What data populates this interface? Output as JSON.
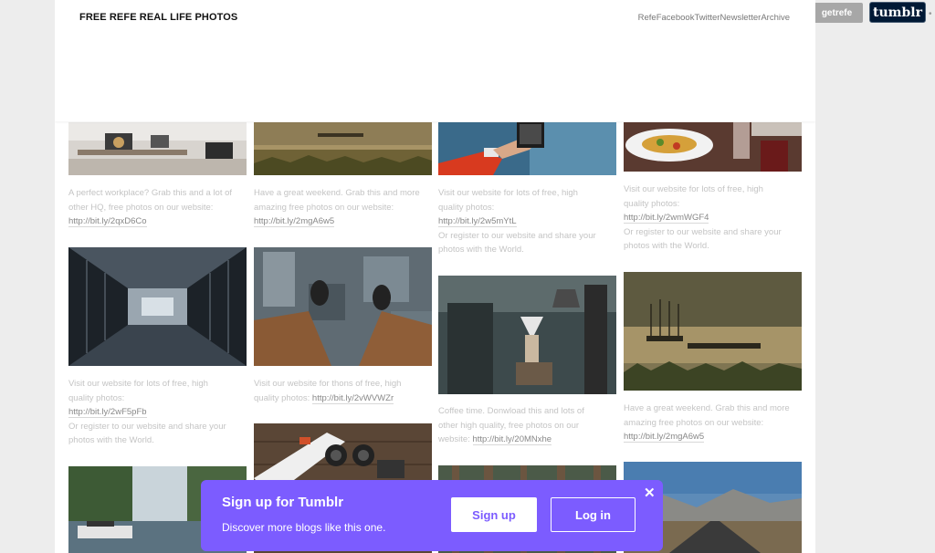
{
  "blog": {
    "title": "FREE REFE REAL LIFE PHOTOS",
    "nav": [
      "Refe",
      "Facebook",
      "Twitter",
      "Newsletter",
      "Archive"
    ]
  },
  "tumblr_controls": {
    "follow_label": "getrefe",
    "logo_label": "tumblr"
  },
  "posts": {
    "col1": [
      {
        "photo_icon": "office-workplace-photo",
        "caption": [
          "A perfect workplace? Grab this and a lot of",
          "other HQ, free photos on our website:"
        ],
        "link": "http://bit.ly/2qxD6Co"
      },
      {
        "photo_icon": "industrial-corridor-photo",
        "caption": [
          "Visit our website for lots of free, high",
          "quality photos:"
        ],
        "link": "http://bit.ly/2wF5pFb",
        "after": [
          "Or register to our website and share your",
          "photos with the World."
        ]
      },
      {
        "photo_icon": "river-canal-photo"
      }
    ],
    "col2": [
      {
        "photo_icon": "misty-lake-photo",
        "caption": [
          "Have a great weekend. Grab this and more",
          "amazing free photos on our website:"
        ],
        "link": "http://bit.ly/2mgA6w5"
      },
      {
        "photo_icon": "feet-above-city-photo",
        "caption": [
          "Visit our website for thons of free, high"
        ],
        "inline_prefix": "quality photos: ",
        "link": "http://bit.ly/2vWVWZr"
      },
      {
        "photo_icon": "skateboard-photo"
      }
    ],
    "col3": [
      {
        "photo_icon": "phone-in-hand-photo",
        "caption": [
          "Visit our website for lots of free, high",
          "quality photos:"
        ],
        "link": "http://bit.ly/2w5mYtL",
        "after": [
          "Or register to our website and share your",
          "photos with the World."
        ]
      },
      {
        "photo_icon": "coffee-brewing-photo",
        "caption": [
          "Coffee time. Donwload this and lots of",
          "other high quality, free photos on our"
        ],
        "inline_prefix": "website: ",
        "link": "http://bit.ly/20MNxhe"
      },
      {
        "photo_icon": "forest-photo"
      }
    ],
    "col4": [
      {
        "photo_icon": "restaurant-dinner-photo",
        "caption": [
          "Visit our website for lots of free, high",
          "quality photos:"
        ],
        "link": "http://bit.ly/2wmWGF4",
        "after": [
          "Or register to our website and share your",
          "photos with the World."
        ]
      },
      {
        "photo_icon": "misty-lake-boat-photo",
        "caption": [
          "Have a great weekend. Grab this and more",
          "amazing free photos on our website:"
        ],
        "link": "http://bit.ly/2mgA6w5"
      },
      {
        "photo_icon": "mountain-road-photo"
      }
    ]
  },
  "signup_banner": {
    "title": "Sign up for Tumblr",
    "subtitle": "Discover more blogs like this one.",
    "signup_label": "Sign up",
    "login_label": "Log in",
    "close_label": "✕"
  }
}
